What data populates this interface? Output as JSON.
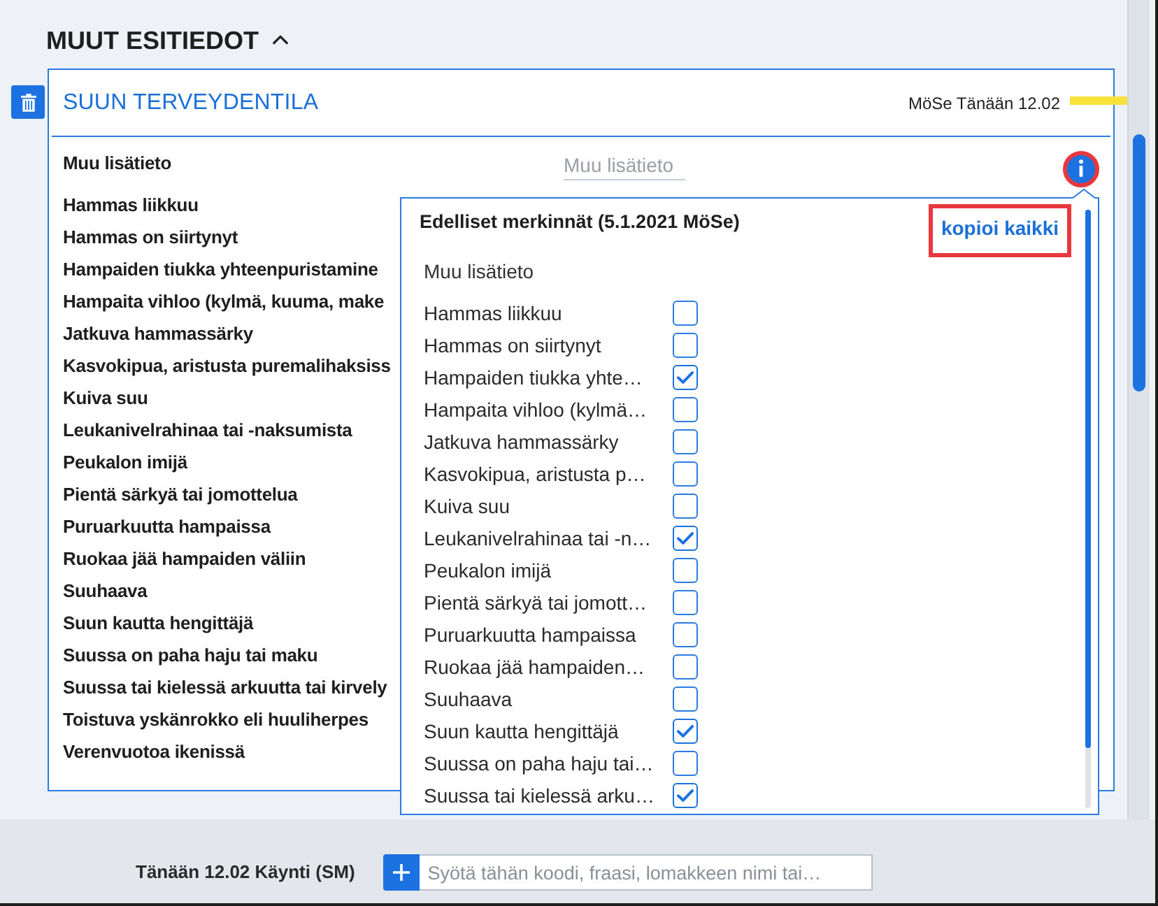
{
  "section": {
    "title": "MUUT ESITIEDOT",
    "expanded": true
  },
  "card": {
    "title": "SUUN TERVEYDENTILA",
    "meta": "MöSe Tänään 12.02",
    "note_field": {
      "label": "Muu lisätieto",
      "placeholder": "Muu lisätieto"
    },
    "items": [
      "Hammas liikkuu",
      "Hammas on siirtynyt",
      "Hampaiden tiukka yhteenpuristamine",
      "Hampaita vihloo (kylmä, kuuma, make",
      "Jatkuva hammassärky",
      "Kasvokipua, aristusta puremalihaksiss",
      "Kuiva suu",
      "Leukanivelrahinaa tai -naksumista",
      "Peukalon imijä",
      "Pientä särkyä tai jomottelua",
      "Puruarkuutta hampaissa",
      "Ruokaa jää hampaiden väliin",
      "Suuhaava",
      "Suun kautta hengittäjä",
      "Suussa on paha haju tai maku",
      "Suussa tai kielessä arkuutta tai kirvely",
      "Toistuva yskänrokko eli huuliherpes",
      "Verenvuotoa ikenissä"
    ]
  },
  "popover": {
    "title": "Edelliset merkinnät (5.1.2021 MöSe)",
    "action": "kopioi kaikki",
    "note_label": "Muu lisätieto",
    "items": [
      {
        "label": "Hammas liikkuu",
        "checked": false
      },
      {
        "label": "Hammas on siirtynyt",
        "checked": false
      },
      {
        "label": "Hampaiden tiukka yhte…",
        "checked": true
      },
      {
        "label": "Hampaita vihloo (kylmä…",
        "checked": false
      },
      {
        "label": "Jatkuva hammassärky",
        "checked": false
      },
      {
        "label": "Kasvokipua, aristusta p…",
        "checked": false
      },
      {
        "label": "Kuiva suu",
        "checked": false
      },
      {
        "label": "Leukanivelrahinaa tai -n…",
        "checked": true
      },
      {
        "label": "Peukalon imijä",
        "checked": false
      },
      {
        "label": "Pientä särkyä tai jomott…",
        "checked": false
      },
      {
        "label": "Puruarkuutta hampaissa",
        "checked": false
      },
      {
        "label": "Ruokaa jää hampaiden…",
        "checked": false
      },
      {
        "label": "Suuhaava",
        "checked": false
      },
      {
        "label": "Suun kautta hengittäjä",
        "checked": true
      },
      {
        "label": "Suussa on paha haju tai…",
        "checked": false
      },
      {
        "label": "Suussa tai kielessä arku…",
        "checked": true
      }
    ]
  },
  "footer": {
    "visit": "Tänään 12.02 Käynti (SM)",
    "search": {
      "placeholder": "Syötä tähän koodi, fraasi, lomakkeen nimi tai…"
    }
  }
}
